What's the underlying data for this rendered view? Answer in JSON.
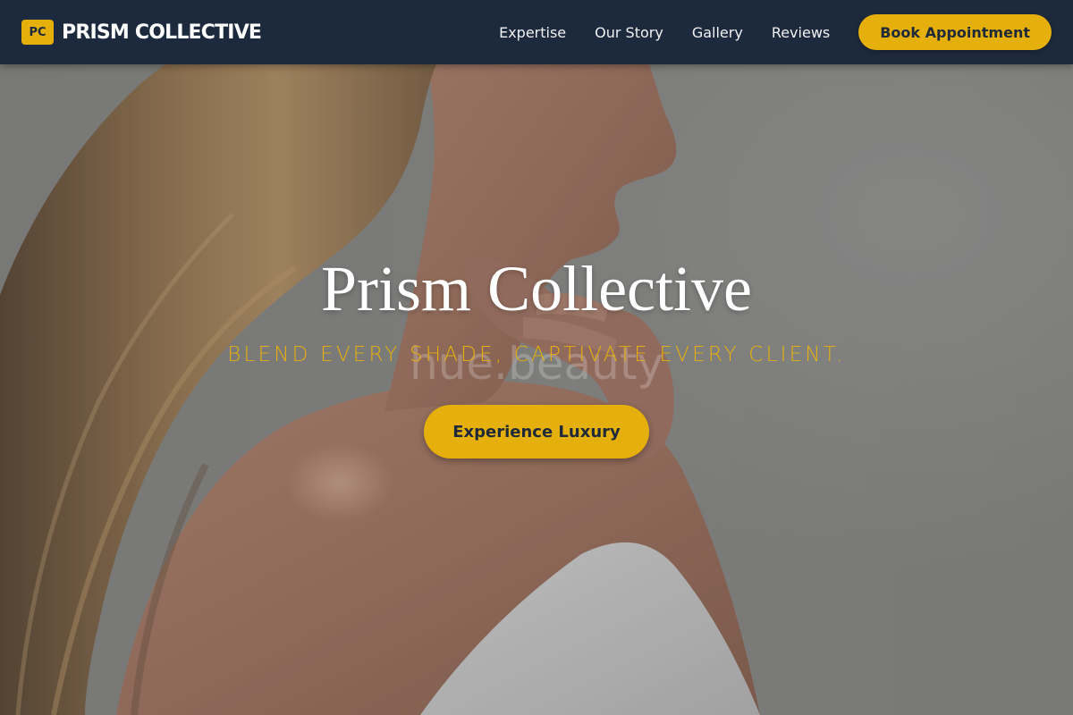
{
  "brand": {
    "badge": "PC",
    "name": "PRISM COLLECTIVE"
  },
  "nav": {
    "links": [
      "Expertise",
      "Our Story",
      "Gallery",
      "Reviews"
    ],
    "book_label": "Book Appointment"
  },
  "hero": {
    "title": "Prism Collective",
    "tagline": "BLEND EVERY SHADE, CAPTIVATE EVERY CLIENT.",
    "watermark": "hue.beauty",
    "cta_label": "Experience Luxury",
    "background_image": "woman-profile-hair-photo"
  },
  "colors": {
    "nav_bg": "#1d2a3e",
    "accent": "#e6b00c",
    "button_text": "#1f2a38"
  }
}
